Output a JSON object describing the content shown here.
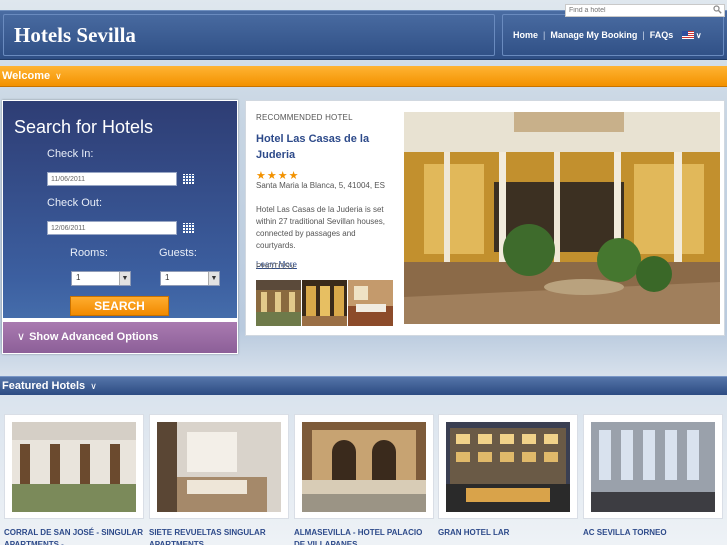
{
  "header": {
    "brand": "Hotels Sevilla",
    "nav": {
      "home": "Home",
      "manage_booking": "Manage My Booking",
      "faqs": "FAQs",
      "separator": "|"
    }
  },
  "welcome": {
    "label": "Welcome",
    "find_placeholder": "Find a hotel"
  },
  "search": {
    "title": "Search for Hotels",
    "check_in_label": "Check In:",
    "check_in_value": "11/06/2011",
    "check_out_label": "Check Out:",
    "check_out_value": "12/06/2011",
    "rooms_label": "Rooms:",
    "rooms_value": "1",
    "guests_label": "Guests:",
    "guests_value": "1",
    "button": "SEARCH",
    "advanced": "Show Advanced Options"
  },
  "recommended": {
    "kicker": "RECOMMENDED HOTEL",
    "name": "Hotel Las Casas de la Juderia",
    "stars": "★★★★",
    "address": "Santa Maria la Blanca, 5, 41004, ES",
    "description": "Hotel Las Casas de la Juderia is set within 27 traditional Sevillan houses, connected by passages and courtyards.",
    "learn_more": "Learn More",
    "photos": "PHOTOS"
  },
  "featured": {
    "label": "Featured Hotels",
    "hotels": [
      {
        "name": "CORRAL DE SAN JOSÉ - SINGULAR APARTMENTS -"
      },
      {
        "name": "SIETE REVUELTAS SINGULAR APARTMENTS"
      },
      {
        "name": "ALMASEVILLA - HOTEL PALACIO DE VILLAPANES"
      },
      {
        "name": "GRAN HOTEL LAR"
      },
      {
        "name": "AC SEVILLA TORNEO"
      }
    ]
  },
  "colors": {
    "accent_orange": "#f39200",
    "brand_blue": "#2f4f85",
    "link_blue": "#2d4a8a",
    "advanced_purple": "#9a6aa6"
  }
}
